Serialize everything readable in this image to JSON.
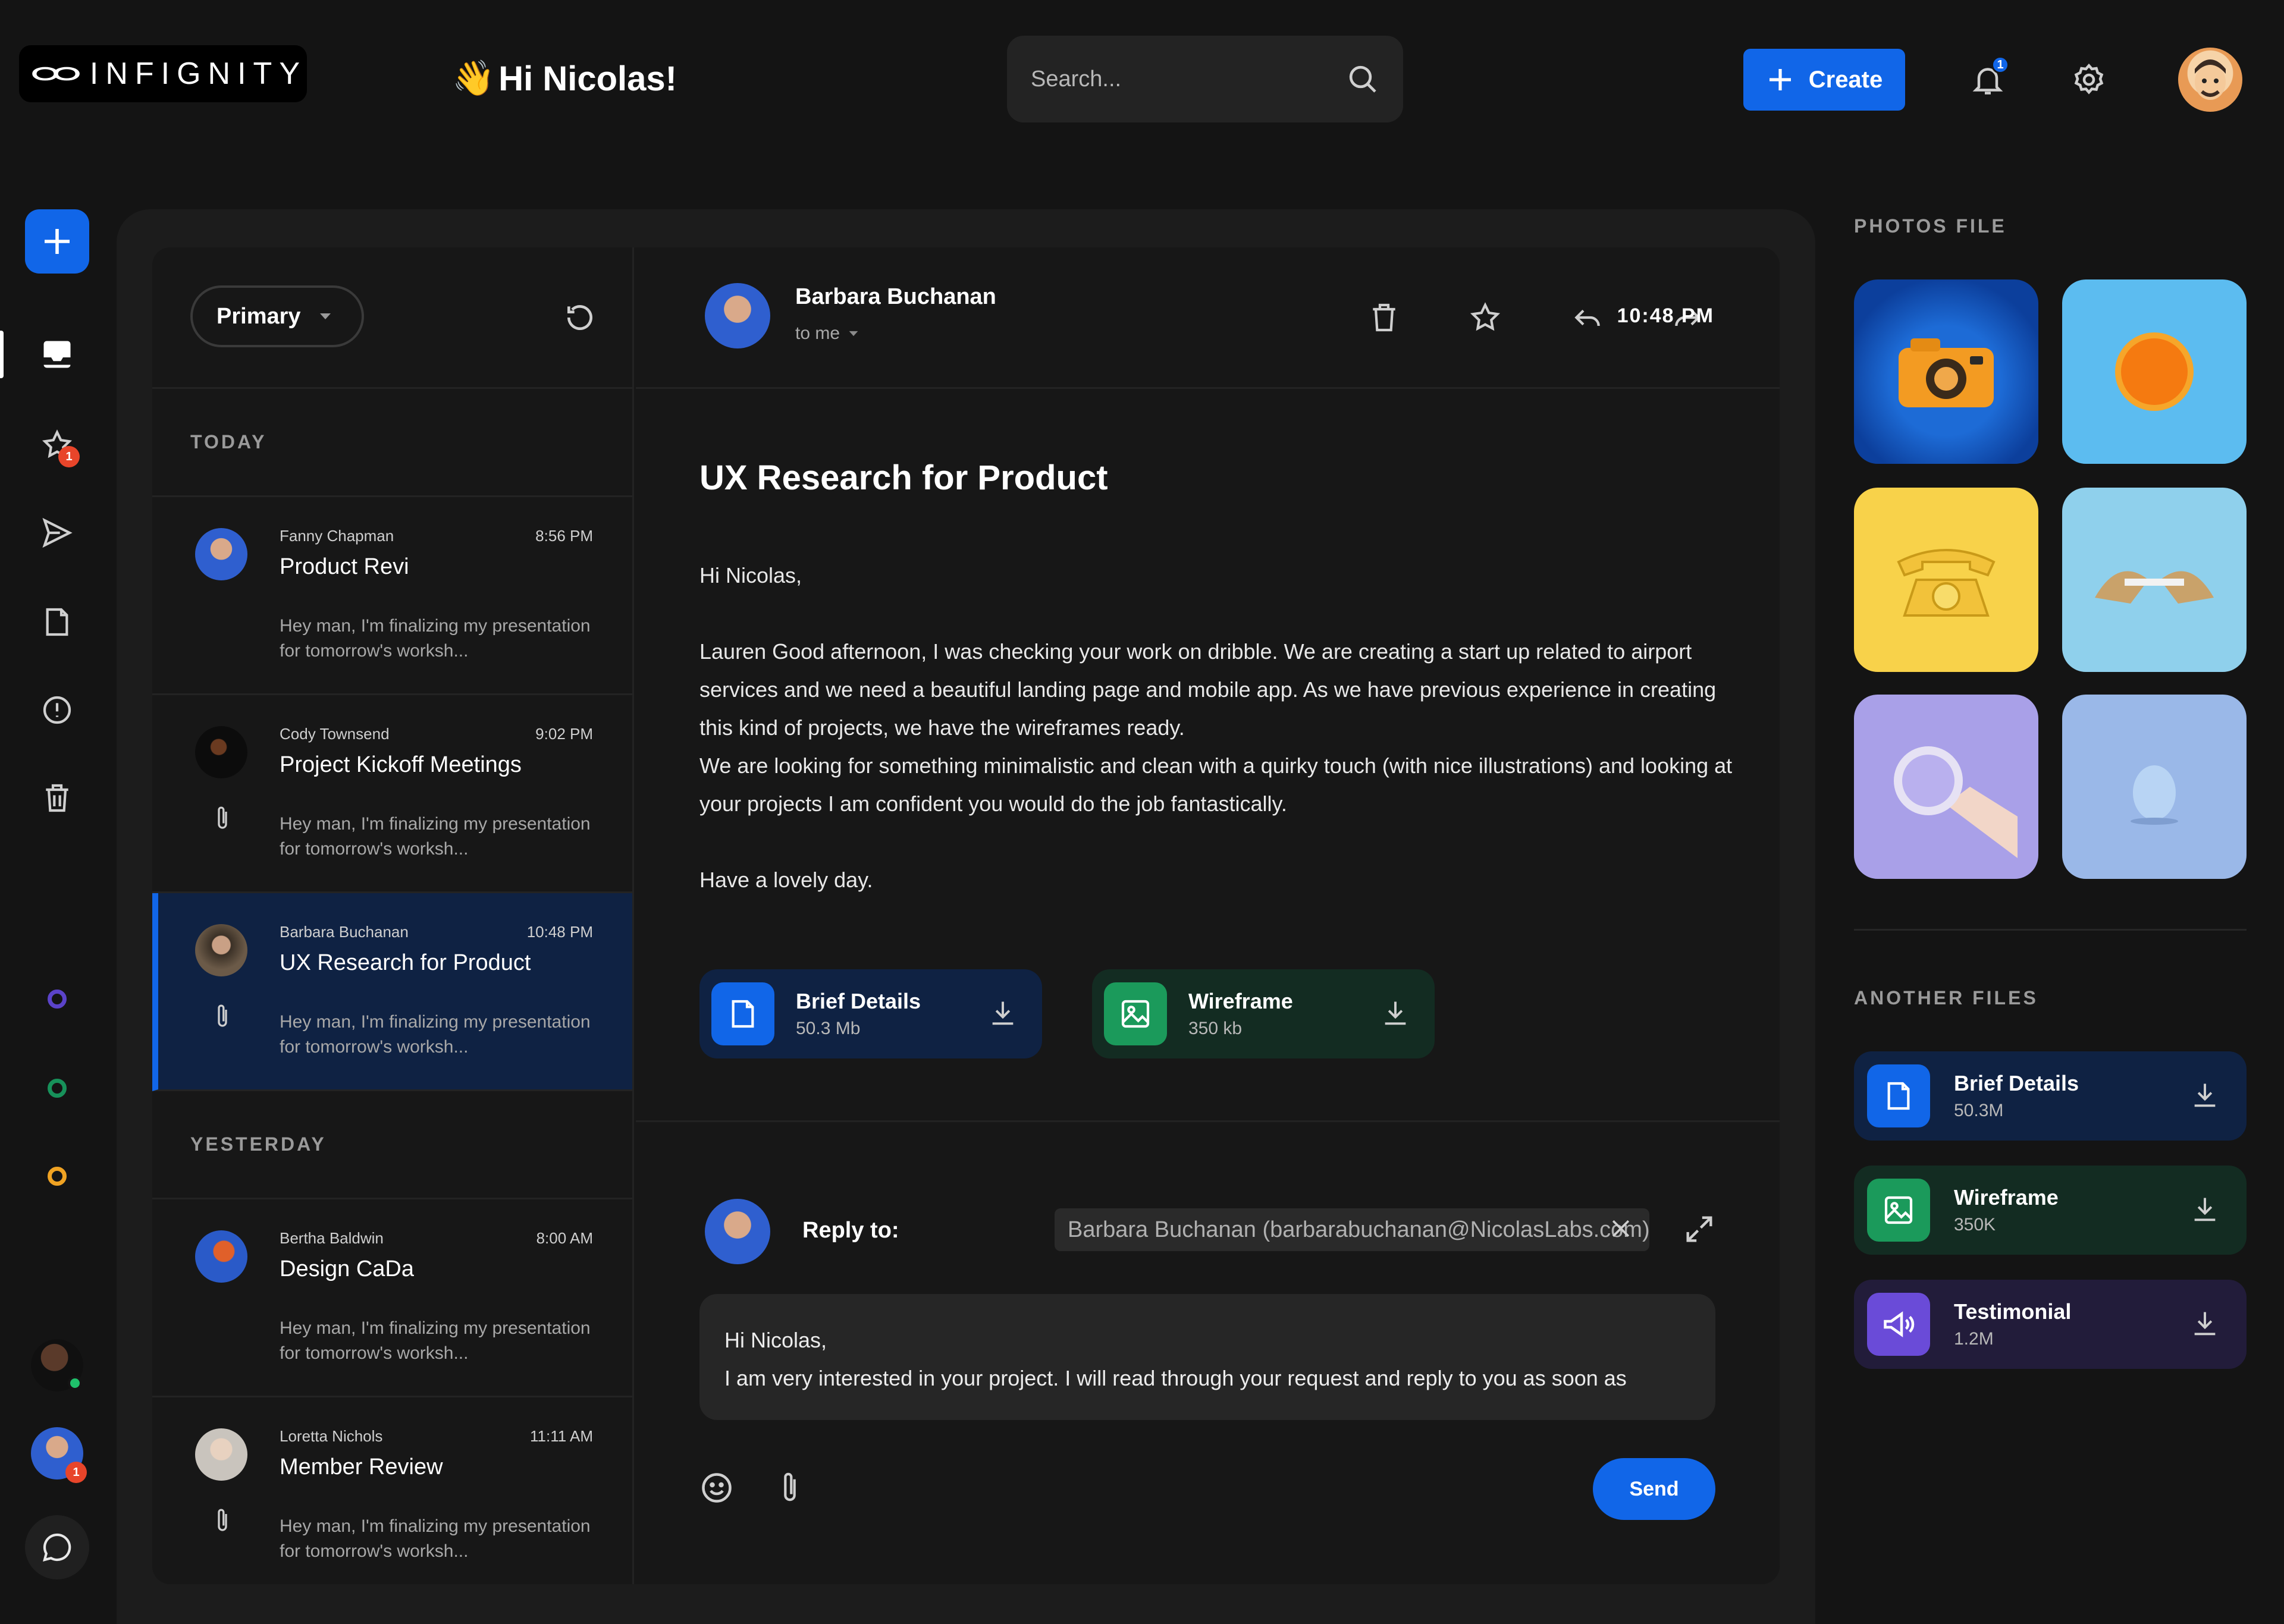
{
  "app": {
    "logo_text": "INFIGNITY"
  },
  "header": {
    "greeting_emoji": "👋",
    "greeting": "Hi Nicolas!",
    "search_placeholder": "Search...",
    "create_label": "Create",
    "notification_count": "1"
  },
  "rail": {
    "starred_badge": "1",
    "avatar_badge": "1"
  },
  "list": {
    "filter_label": "Primary",
    "today_label": "TODAY",
    "yesterday_label": "YESTERDAY",
    "items": [
      {
        "sender": "Fanny Chapman",
        "time": "8:56 PM",
        "subject": "Product Revi",
        "preview": "Hey man, I'm finalizing my presentation for tomorrow's worksh..."
      },
      {
        "sender": "Cody Townsend",
        "time": "9:02 PM",
        "subject": "Project Kickoff Meetings",
        "preview": "Hey man, I'm finalizing my presentation for tomorrow's worksh..."
      },
      {
        "sender": "Barbara Buchanan",
        "time": "10:48 PM",
        "subject": "UX Research for Product",
        "preview": "Hey man, I'm finalizing my presentation for tomorrow's worksh..."
      },
      {
        "sender": "Bertha Baldwin",
        "time": "8:00 AM",
        "subject": "Design CaDa",
        "preview": "Hey man, I'm finalizing my presentation for tomorrow's worksh..."
      },
      {
        "sender": "Loretta Nichols",
        "time": "11:11 AM",
        "subject": "Member Review",
        "preview": "Hey man, I'm finalizing my presentation for tomorrow's worksh..."
      }
    ]
  },
  "email": {
    "from": "Barbara Buchanan",
    "to": "to me",
    "time": "10:48 PM",
    "subject": "UX Research for Product",
    "greeting": "Hi Nicolas,",
    "paragraph1": "Lauren Good afternoon, I was checking your work on dribble. We are creating a start up related to airport services and we need a beautiful landing page and mobile app. As we have previous experience in creating this kind of projects, we have the wireframes ready.",
    "paragraph2": "We are looking for something minimalistic and clean with a quirky touch (with nice illustrations) and looking at your projects I am confident you would do the job fantastically.",
    "closing": "Have a lovely day.",
    "attachments": [
      {
        "name": "Brief Details",
        "size": "50.3 Mb"
      },
      {
        "name": "Wireframe",
        "size": "350 kb"
      }
    ]
  },
  "reply": {
    "label": "Reply to:",
    "to_value": "Barbara Buchanan (barbarabuchanan@NicolasLabs.com)",
    "line1": "Hi Nicolas,",
    "line2": "I am very interested in your project. I will read through your request and reply to you as soon as",
    "send_label": "Send"
  },
  "right_panel": {
    "photos_label": "PHOTOS FILE",
    "files_label": "ANOTHER FILES",
    "files": [
      {
        "name": "Brief Details",
        "size": "50.3M"
      },
      {
        "name": "Wireframe",
        "size": "350K"
      },
      {
        "name": "Testimonial",
        "size": "1.2M"
      }
    ]
  },
  "colors": {
    "accent": "#1166e8",
    "green": "#1b9a5b",
    "purple": "#6a4bd8",
    "badge_red": "#e8452a"
  }
}
